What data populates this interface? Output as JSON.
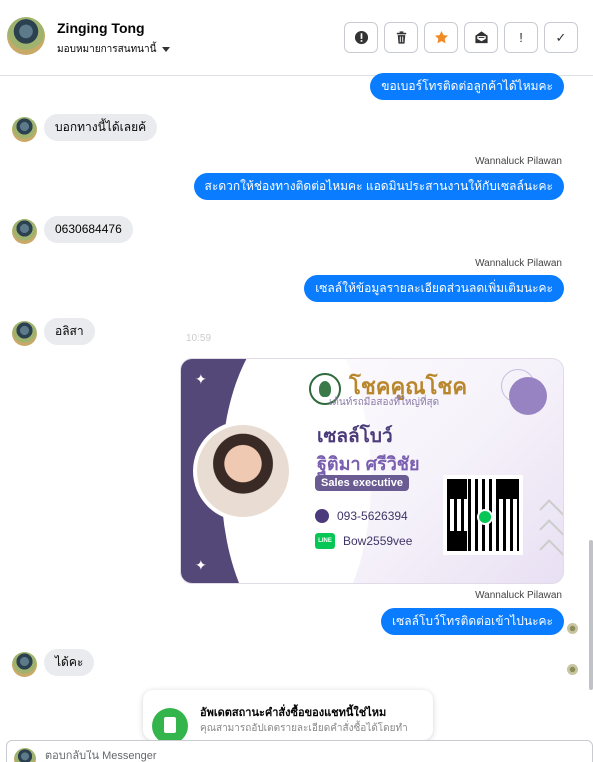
{
  "header": {
    "contact_name": "Zinging Tong",
    "assignment": "มอบหมายการสนทนานี้",
    "toolbar": {
      "report_icon": "alert-circle-icon",
      "delete_icon": "trash-icon",
      "star_icon": "star-icon",
      "mark_unread_icon": "envelope-icon",
      "flag_icon": "exclamation-icon",
      "done_icon": "check-icon",
      "flag_label": "!",
      "done_label": "✓"
    }
  },
  "messages": [
    {
      "dir": "out",
      "text": "ขอเบอร์โทรติดต่อลูกค้าได้ไหมคะ"
    },
    {
      "dir": "in",
      "text": "บอกทางนี้ได้เลยค้"
    },
    {
      "dir": "out",
      "sender": "Wannaluck Pilawan",
      "text": "สะดวกให้ช่องทางติดต่อไหมคะ แอดมินประสานงานให้กับเซลล์นะคะ"
    },
    {
      "dir": "in",
      "text": "0630684476"
    },
    {
      "dir": "out",
      "sender": "Wannaluck Pilawan",
      "text": "เซลล์ให้ข้อมูลรายละเอียดส่วนลดเพิ่มเติมนะคะ"
    },
    {
      "dir": "in",
      "text": "อลิสา"
    },
    {
      "dir": "out",
      "sender": "Wannaluck Pilawan",
      "text": "เซลล์โบว์โทรติดต่อเข้าไปนะคะ"
    },
    {
      "dir": "in",
      "text": "ได้คะ"
    }
  ],
  "timestamp": "10:59",
  "business_card": {
    "brand": "โชคคูณโชค",
    "tagline": "เต้นท์รถมือสองที่ใหญ่ที่สุด",
    "nickname": "เซลล์โบว์",
    "full_name": "ฐิติมา  ศรีวิชัย",
    "role": "Sales executive",
    "phone": "093-5626394",
    "line_id": "Bow2559vee",
    "line_badge": "LINE",
    "accent_color": "#6a5b93"
  },
  "notice": {
    "title": "อัพเดตสถานะคำสั่งซื้อของแชทนี้ใช่ไหม",
    "subtitle": "คุณสามารถอัปเดตรายละเอียดคำสั่งซื้อได้โดยทำ"
  },
  "composer": {
    "placeholder": "ตอบกลับใน Messenger"
  },
  "colors": {
    "outgoing_bubble": "#0a7cff",
    "incoming_bubble": "#e9ebee",
    "star": "#f08a24"
  }
}
